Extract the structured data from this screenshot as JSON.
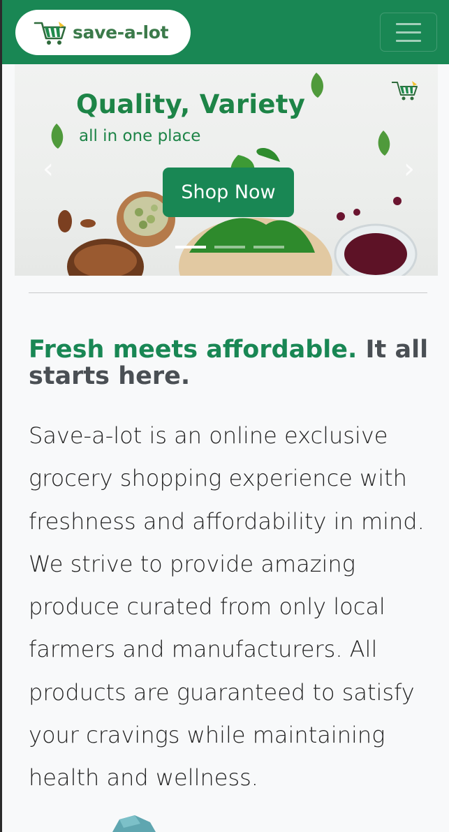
{
  "navbar": {
    "brand_text": "save-a-lot",
    "toggler_icon": "hamburger-icon"
  },
  "carousel": {
    "title": "Quality, Variety",
    "subtitle": "all in one place",
    "cta_label": "Shop Now",
    "prev_glyph": "‹",
    "next_glyph": "›"
  },
  "about": {
    "headline_green": "Fresh meets affordable.",
    "headline_rest": "It all starts here.",
    "paragraph": "Save-a-lot is an online exclusive grocery shopping experience with freshness and affordability in mind. We strive to provide amazing produce curated from only local farmers and manufacturers. All products are guaranteed to satisfy your cravings while maintaining health and wellness."
  },
  "colors": {
    "brand_green": "#198754",
    "text_dark": "#222222",
    "headline_gray": "#4a4f54",
    "page_bg": "#f8f9fa"
  }
}
